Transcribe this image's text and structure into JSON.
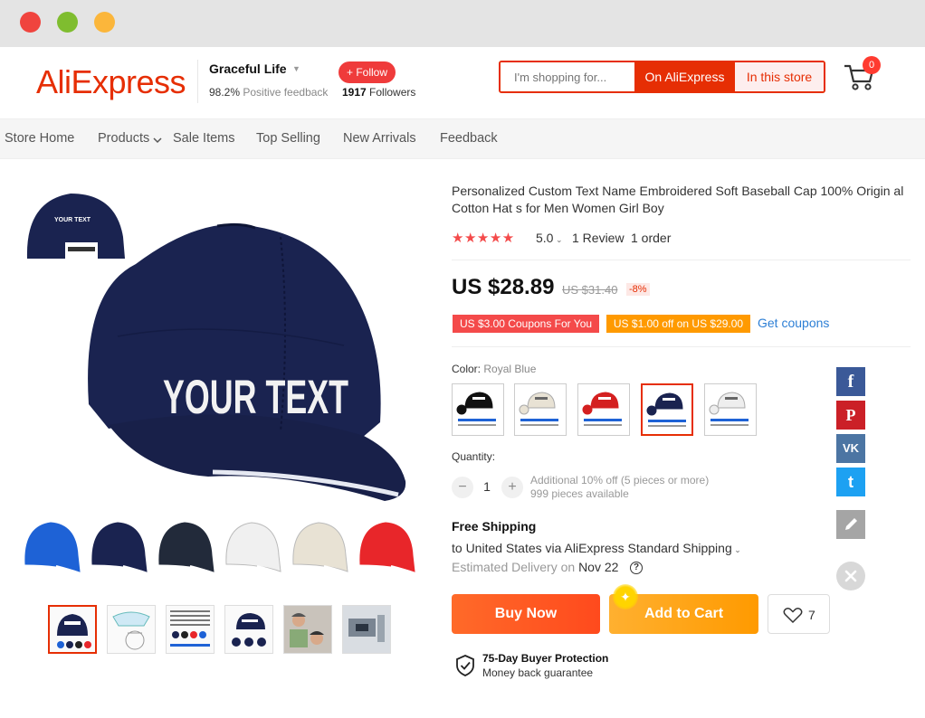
{
  "header": {
    "logo": "AliExpress",
    "store_name": "Graceful Life",
    "feedback_value": "98.2%",
    "feedback_label": "Positive feedback",
    "follow_label": "+ Follow",
    "followers_count": "1917",
    "followers_label": "Followers",
    "search_placeholder": "I'm shopping for...",
    "search_on_label": "On AliExpress",
    "search_store_label": "In this store",
    "cart_count": "0"
  },
  "nav": {
    "items": [
      "Store Home",
      "Products",
      "Sale Items",
      "Top Selling",
      "New Arrivals",
      "Feedback"
    ]
  },
  "gallery": {
    "main_text": "YOUR TEXT",
    "inset_text": "YOUR TEXT",
    "swatch_colors": [
      "#1e62d6",
      "#1a2350",
      "#222a3a",
      "#f0f0f0",
      "#e8e2d4",
      "#e8262a"
    ],
    "thumbnail_count": 6
  },
  "product": {
    "title": "Personalized Custom Text Name Embroidered Soft Baseball Cap 100% Origin al Cotton Hat s for Men Women Girl Boy",
    "stars": "★★★★★",
    "rating": "5.0",
    "reviews": "1 Review",
    "orders": "1 order",
    "price": "US $28.89",
    "old_price": "US $31.40",
    "discount": "-8%",
    "coupon1": "US $3.00 Coupons For You",
    "coupon2": "US $1.00 off on US $29.00",
    "get_coupons": "Get coupons",
    "color_label": "Color:",
    "color_value": "Royal Blue",
    "color_options": [
      "#111111",
      "#e8e2d4",
      "#d42020",
      "#1a2350",
      "#eeeeee"
    ],
    "color_selected_index": 3,
    "quantity_label": "Quantity:",
    "quantity": "1",
    "qty_note1": "Additional 10% off (5 pieces or more)",
    "qty_note2": "999 pieces available",
    "shipping_title": "Free Shipping",
    "shipping_to": "to United States via AliExpress Standard Shipping",
    "delivery_label": "Estimated Delivery on",
    "delivery_date": "Nov 22",
    "buy_now": "Buy Now",
    "add_to_cart": "Add to Cart",
    "wishlist_count": "7",
    "protection_title": "75-Day Buyer Protection",
    "protection_sub": "Money back guarantee"
  },
  "social": {
    "facebook": "f",
    "pinterest": "P",
    "vk": "VK",
    "twitter": "t",
    "colors": {
      "facebook": "#3b5998",
      "pinterest": "#cb2027",
      "vk": "#4c75a3",
      "twitter": "#1da1f2",
      "edit": "#a5a5a5"
    }
  }
}
